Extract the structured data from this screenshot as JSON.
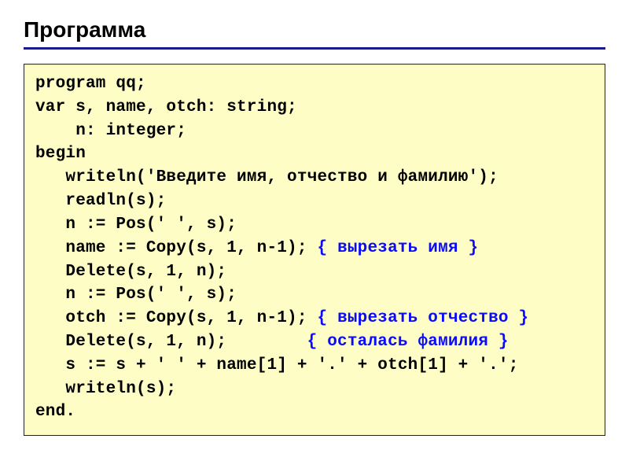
{
  "title": "Программа",
  "code": {
    "l1": "program qq;",
    "l2": "var s, name, otch: string;",
    "l3": "    n: integer;",
    "l4": "begin",
    "l5": "   writeln('Введите имя, отчество и фамилию');",
    "l6": "   readln(s);",
    "l7": "   n := Pos(' ', s);",
    "l8a": "   name := Copy(s, 1, n-1); ",
    "l8c": "{ вырезать имя }",
    "l9": "   Delete(s, 1, n);",
    "l10": "   n := Pos(' ', s);",
    "l11a": "   otch := Copy(s, 1, n-1); ",
    "l11c": "{ вырезать отчество }",
    "l12a": "   Delete(s, 1, n);        ",
    "l12c": "{ осталась фамилия }",
    "l13": "   s := s + ' ' + name[1] + '.' + otch[1] + '.';",
    "l14": "   writeln(s);",
    "l15": "end."
  }
}
